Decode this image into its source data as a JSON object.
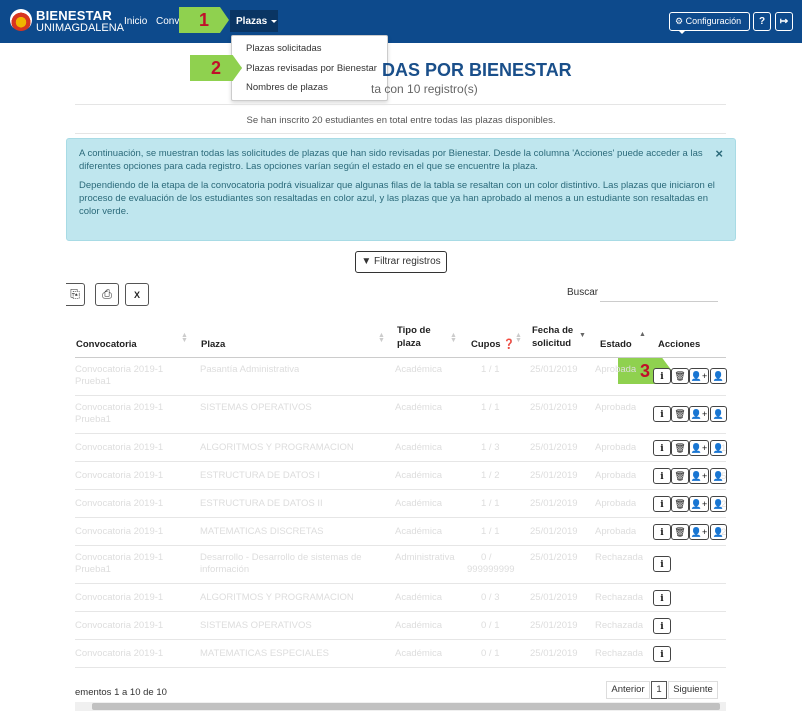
{
  "nav": {
    "brand_line1": "BIENESTAR",
    "brand_line2": "UNIMAGDALENA",
    "links": [
      "Inicio",
      "Conv"
    ],
    "plazas_label": "Plazas",
    "config_label": "Configuración",
    "help_icon": "question-icon",
    "logout_icon": "logout-icon"
  },
  "callouts": [
    "1",
    "2",
    "3"
  ],
  "dropdown": {
    "items": [
      "Plazas solicitadas",
      "Plazas revisadas por Bienestar",
      "Nombres de plazas"
    ]
  },
  "page": {
    "title": "DAS POR BIENESTAR",
    "subtitle": "ta con 10 registro(s)",
    "inscritos": "Se han inscrito 20 estudiantes en total entre todas las plazas disponibles."
  },
  "alert": {
    "p1": "A continuación, se muestran todas las solicitudes de plazas que han sido revisadas por Bienestar. Desde la columna 'Acciones' puede acceder a las diferentes opciones para cada registro. Las opciones varían según el estado en el que se encuentre la plaza.",
    "p2": "Dependiendo de la etapa de la convocatoria podrá visualizar que algunas filas de la tabla se resaltan con un color distintivo. Las plazas que iniciaron el proceso de evaluación de los estudiantes son resaltadas en color azul, y las plazas que ya han aprobado al menos a un estudiante son resaltadas en color verde.",
    "close": "×"
  },
  "filter_label": "Filtrar registros",
  "buscar_label": "Buscar",
  "table": {
    "headers": {
      "convocatoria": "Convocatoria",
      "plaza": "Plaza",
      "tipo1": "Tipo de",
      "tipo2": "plaza",
      "cupos": "Cupos",
      "fecha1": "Fecha de",
      "fecha2": "solicitud",
      "estado": "Estado",
      "acciones": "Acciones"
    },
    "rows": [
      {
        "conv1": "Convocatoria 2019-1",
        "conv2": "Prueba1",
        "plaza1": "Pasantía Administrativa",
        "plaza2": "",
        "tipo": "Académica",
        "cupos1": "1 / 1",
        "cupos2": "",
        "fecha": "25/01/2019",
        "estado": "Aprobada",
        "extra": ""
      },
      {
        "conv1": "Convocatoria 2019-1",
        "conv2": "Prueba1",
        "plaza1": "SISTEMAS OPERATIVOS",
        "plaza2": "",
        "tipo": "Académica",
        "cupos1": "1 / 1",
        "cupos2": "",
        "fecha": "25/01/2019",
        "estado": "Aprobada",
        "extra": ""
      },
      {
        "conv1": "Convocatoria 2019-1",
        "conv2": "",
        "plaza1": "ALGORITMOS Y PROGRAMACION",
        "plaza2": "",
        "tipo": "Académica",
        "cupos1": "1 / 3",
        "cupos2": "",
        "fecha": "25/01/2019",
        "estado": "Aprobada",
        "extra": "1"
      },
      {
        "conv1": "Convocatoria 2019-1",
        "conv2": "",
        "plaza1": "ESTRUCTURA DE DATOS I",
        "plaza2": "",
        "tipo": "Académica",
        "cupos1": "1 / 2",
        "cupos2": "",
        "fecha": "25/01/2019",
        "estado": "Aprobada",
        "extra": "5"
      },
      {
        "conv1": "Convocatoria 2019-1",
        "conv2": "",
        "plaza1": "ESTRUCTURA DE DATOS II",
        "plaza2": "",
        "tipo": "Académica",
        "cupos1": "1 / 1",
        "cupos2": "",
        "fecha": "25/01/2019",
        "estado": "Aprobada",
        "extra": "2"
      },
      {
        "conv1": "Convocatoria 2019-1",
        "conv2": "",
        "plaza1": "MATEMATICAS DISCRETAS",
        "plaza2": "",
        "tipo": "Académica",
        "cupos1": "1 / 1",
        "cupos2": "",
        "fecha": "25/01/2019",
        "estado": "Aprobada",
        "extra": "2"
      },
      {
        "conv1": "Convocatoria 2019-1",
        "conv2": "Prueba1",
        "plaza1": "Desarrollo - Desarrollo de sistemas de",
        "plaza2": "información",
        "tipo": "Administrativa",
        "cupos1": "0 /",
        "cupos2": "999999999",
        "fecha": "25/01/2019",
        "estado": "Rechazada",
        "extra": ""
      },
      {
        "conv1": "Convocatoria 2019-1",
        "conv2": "",
        "plaza1": "ALGORITMOS Y PROGRAMACION",
        "plaza2": "",
        "tipo": "Académica",
        "cupos1": "0 / 3",
        "cupos2": "",
        "fecha": "25/01/2019",
        "estado": "Rechazada",
        "extra": ""
      },
      {
        "conv1": "Convocatoria 2019-1",
        "conv2": "",
        "plaza1": "SISTEMAS OPERATIVOS",
        "plaza2": "",
        "tipo": "Académica",
        "cupos1": "0 / 1",
        "cupos2": "",
        "fecha": "25/01/2019",
        "estado": "Rechazada",
        "extra": ""
      },
      {
        "conv1": "Convocatoria 2019-1",
        "conv2": "",
        "plaza1": "MATEMATICAS ESPECIALES",
        "plaza2": "",
        "tipo": "Académica",
        "cupos1": "0 / 1",
        "cupos2": "",
        "fecha": "25/01/2019",
        "estado": "Rechazada",
        "extra": ""
      }
    ]
  },
  "footer": {
    "info": "ementos 1 a 10 de 10",
    "prev": "Anterior",
    "page": "1",
    "next": "Siguiente"
  },
  "colors": {
    "navbar": "#0d4a8c",
    "title": "#1a4f8a",
    "alert_bg": "#bfe6ee",
    "callout": "#8fd14f",
    "callout_text": "#c0102a"
  }
}
